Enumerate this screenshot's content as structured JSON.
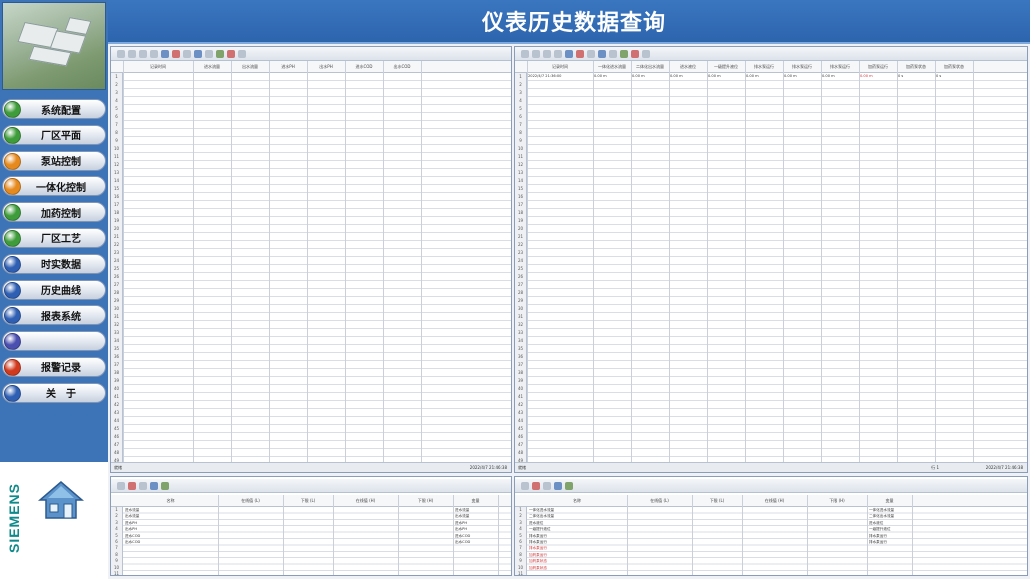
{
  "header": {
    "title": "仪表历史数据查询"
  },
  "sidebar": {
    "menu": [
      {
        "label": "系统配置",
        "color": "#3e9c3a"
      },
      {
        "label": "厂区平面",
        "color": "#3e9c3a"
      },
      {
        "label": "泵站控制",
        "color": "#e68a1e"
      },
      {
        "label": "一体化控制",
        "color": "#e68a1e"
      },
      {
        "label": "加药控制",
        "color": "#3e9c3a"
      },
      {
        "label": "厂区工艺",
        "color": "#3e9c3a"
      },
      {
        "label": "时实数据",
        "color": "#2f5fb3"
      },
      {
        "label": "历史曲线",
        "color": "#2f5fb3"
      },
      {
        "label": "报表系统",
        "color": "#2f5fb3"
      },
      {
        "label": "",
        "color": "#4a4fb0"
      },
      {
        "label": "报警记录",
        "color": "#d23a1e"
      },
      {
        "label": "关　于",
        "color": "#2f5fb3"
      }
    ],
    "brand": "SIEMENS"
  },
  "left_panel": {
    "columns": [
      "记录时间",
      "进水流量",
      "出水流量",
      "进水PH",
      "出水PH",
      "进水COD",
      "出水COD"
    ],
    "status_left": "就绪",
    "status_right": "2022/4/7  21:46:38"
  },
  "right_panel": {
    "columns": [
      "记录时间",
      "一体化进水流量",
      "二体化出水流量",
      "进水液位",
      "一级提升液位",
      "排水泵运行",
      "排水泵运行",
      "排水泵运行",
      "加药泵运行",
      "加药泵状态",
      "加药泵状态"
    ],
    "first_row": [
      "2022/4/7 21:36:00",
      "0.00 m",
      "0.00 m",
      "0.00 m",
      "0.00 m",
      "0.00 m",
      "0.00 m",
      "0.00 m",
      "0.00 m",
      "0 s",
      "0 s"
    ],
    "status_left": "就绪",
    "status_mid": "行 1",
    "status_right": "2022/4/7  21:46:38"
  },
  "left_tag_table": {
    "columns": [
      "名称",
      "在线值 (L)",
      "下限 (L)",
      "在线值 (H)",
      "下限 (H)",
      "变量"
    ],
    "names": [
      "进水流量",
      "出水流量",
      "进水PH",
      "出水PH",
      "进水COD",
      "出水COD"
    ],
    "vars": [
      "进水流量",
      "出水流量",
      "进水PH",
      "出水PH",
      "进水COD",
      "出水COD"
    ]
  },
  "right_tag_table": {
    "columns": [
      "名称",
      "在线值 (L)",
      "下限 (L)",
      "在线值 (H)",
      "下限 (H)",
      "变量"
    ],
    "names": [
      "一体化进水流量",
      "二体化出水流量",
      "进水液位",
      "一级提升液位",
      "排水泵运行",
      "排水泵运行",
      "排水泵运行",
      "加药泵运行",
      "加药泵状态",
      "加药泵状态"
    ],
    "vars": [
      "一体化进水流量",
      "二体化出水流量",
      "进水液位",
      "一级提升液位",
      "排水泵运行",
      "排水泵运行"
    ]
  }
}
